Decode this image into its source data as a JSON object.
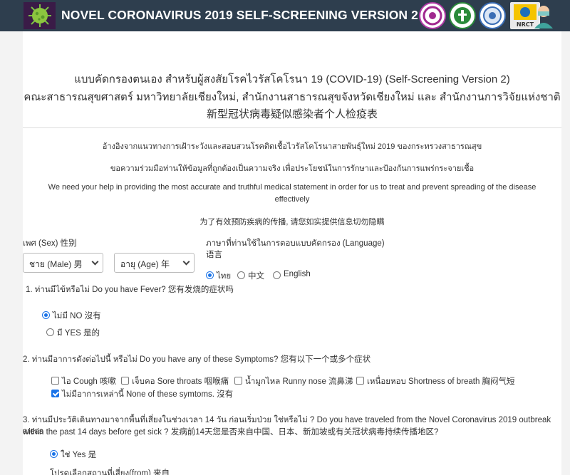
{
  "header": {
    "app_title": "NOVEL CORONAVIRUS 2019 SELF-SCREENING VERSION 2",
    "partner_logos": [
      "partner-logo-1",
      "partner-logo-2",
      "partner-logo-3",
      "nrct-logo"
    ],
    "nrct_text": "วช. NRCT",
    "colors": {
      "bar": "#2e3e4e",
      "logo_bg": "#3a1b47",
      "accent": "#1a73e8"
    }
  },
  "intro": {
    "title_line1": "แบบคัดกรองตนเอง สำหรับผู้สงสัยโรคไวรัสโคโรนา 19 (COVID-19) (Self-Screening Version 2)",
    "title_line2": "คณะสาธารณสุขศาสตร์ มหาวิทยาลัยเชียงใหม่, สำนักงานสาธารณสุขจังหวัดเชียงใหม่ และ สำนักงานการวิจัยแห่งชาติ",
    "title_line3": "新型冠状病毒疑似感染者个人检疫表",
    "note_th_1": "อ้างอิงจากแนวทางการเฝ้าระวังและสอบสวนโรคติดเชื้อไวรัสโคโรนาสายพันธุ์ใหม่ 2019 ของกระทรวงสาธารณสุข",
    "note_th_2": "ขอความร่วมมือท่านให้ข้อมูลที่ถูกต้องเป็นความจริง เพื่อประโยชน์ในการรักษาและป้องกันการแพร่กระจายเชื้อ",
    "note_en_1": "We need your help in providing the most accurate and truthful medical statement in order for us to treat and prevent spreading of the disease",
    "note_en_2": "effectively",
    "note_zh": "为了有效预防疾病的传播, 请您如实提供信息切勿隐瞒"
  },
  "form": {
    "sex_label": "เพศ (Sex) 性别",
    "sex_value": "ชาย (Male) 男",
    "age_value": "อายุ (Age) 年",
    "lang_label_1": "ภาษาที่ท่านใช้ในการตอบแบบคัดกรอง (Language)",
    "lang_label_2": "语言",
    "lang_options": [
      "ไทย",
      "中文",
      "English"
    ],
    "lang_selected": "ไทย"
  },
  "q1": {
    "text": "1. ท่านมีไข้หรือไม่ Do you have Fever? 您有发烧的症状吗",
    "options": [
      "ไม่มี NO 沒有",
      "มี YES 是的"
    ],
    "selected": "ไม่มี NO 沒有"
  },
  "q2": {
    "text": "2. ท่านมีอาการดังต่อไปนี้ หรือไม่ Do you have any of these Symptoms? 您有以下一个或多个症状",
    "options": [
      "ไอ Cough 咳嗽",
      "เจ็บคอ Sore throats 咽喉痛",
      "น้ำมูกไหล Runny nose 流鼻涕",
      "เหนื่อยหอบ Shortness of breath 胸闷气短",
      "ไม่มีอาการเหล่านี้ None of these symtoms. 沒有"
    ],
    "checked": "ไม่มีอาการเหล่านี้ None of these symtoms. 沒有"
  },
  "q3": {
    "text_line1": "3. ท่านมีประวัติเดินทางมาจากพื้นที่เสี่ยงในช่วงเวลา 14 วัน ก่อนเริ่มป่วย ใช่หรือไม่ ? Do you have traveled from the Novel Coronavirus 2019 outbreak areas",
    "text_line2": "within the past 14 days before get sick ? 发病前14天您是否来自中国、日本、新加坡或有关冠状病毒持续传播地区?",
    "option_yes": "ใช่ Yes 是",
    "selected": "ใช่ Yes 是",
    "followup": "โปรดเลือกสถานที่เสี่ยง(from) 来自"
  }
}
